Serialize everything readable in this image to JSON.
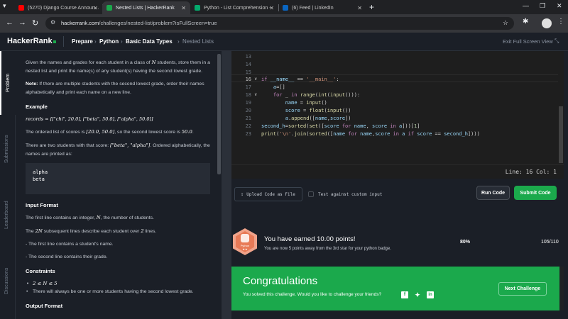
{
  "browser": {
    "tabs": [
      {
        "label": "(5270) Django Course Announ...",
        "fav_color": "#ff0000",
        "active": false
      },
      {
        "label": "Nested Lists | HackerRank",
        "fav_color": "#1ba94c",
        "active": true
      },
      {
        "label": "Python - List Comprehension -",
        "fav_color": "#04aa6d",
        "active": false
      },
      {
        "label": "(6) Feed | LinkedIn",
        "fav_color": "#0a66c2",
        "active": false
      }
    ],
    "url_host": "hackerrank.com",
    "url_path": "/challenges/nested-list/problem?isFullScreen=true"
  },
  "header": {
    "logo": "HackerRank",
    "breadcrumbs": [
      "Prepare",
      "Python",
      "Basic Data Types",
      "Nested Lists"
    ],
    "exit_fullscreen": "Exit Full Screen View"
  },
  "side_tabs": [
    "Problem",
    "Submissions",
    "Leaderboard",
    "Discussions"
  ],
  "problem": {
    "intro_a": "Given the names and grades for each student in a class of ",
    "intro_N": "N",
    "intro_b": " students, store them in a nested list and print the name(s) of any student(s) having the second lowest grade.",
    "note_label": "Note:",
    "note_text": " If there are multiple students with the second lowest grade, order their names alphabetically and print each name on a new line.",
    "example_heading": "Example",
    "example_records": "records = [[\"chi\", 20.0], [\"beta\", 50.0], [\"alpha\", 50.0]]",
    "ordered_a": "The ordered list of scores is ",
    "ordered_list": "[20.0, 50.0]",
    "ordered_b": ", so the second lowest score is ",
    "ordered_val": "50.0",
    "ordered_c": ".",
    "two_students_a": "There are two students with that score: ",
    "two_students_list": "[\"beta\", \"alpha\"]",
    "two_students_b": ". Ordered alphabetically, the names are printed as:",
    "output_line1": "alpha",
    "output_line2": "beta",
    "input_heading": "Input Format",
    "input1_a": "The first line contains an integer, ",
    "input1_N": "N",
    "input1_b": ", the number of students.",
    "input2_a": "The ",
    "input2_2N": "2N",
    "input2_b": " subsequent lines describe each student over ",
    "input2_2": "2",
    "input2_c": " lines.",
    "input3": "- The first line contains a student's name.",
    "input4": "- The second line contains their grade.",
    "constraints_heading": "Constraints",
    "constraint1": "2 ≤ N ≤ 5",
    "constraint2": "There will always be one or more students having the second lowest grade.",
    "output_heading": "Output Format"
  },
  "editor": {
    "line_numbers": [
      "13",
      "14",
      "15",
      "16",
      "17",
      "18",
      "19",
      "20",
      "21",
      "22",
      "23"
    ],
    "status": "Line: 16 Col: 1"
  },
  "actions": {
    "upload": "Upload Code as File",
    "test_custom": "Test against custom input",
    "run": "Run Code",
    "submit": "Submit Code"
  },
  "points": {
    "badge_label": "Python",
    "badge_stars": "★★",
    "title": "You have earned 10.00 points!",
    "subtitle": "You are now 5 points away from the 3rd star for your python badge.",
    "percent": "80%",
    "fraction": "105/110"
  },
  "congrats": {
    "title": "Congratulations",
    "message": "You solved this challenge. Would you like to challenge your friends?",
    "next": "Next Challenge"
  },
  "colors": {
    "accent": "#1ba94c",
    "header_bg": "#1b1f27",
    "editor_bg": "#1e1e1e"
  }
}
